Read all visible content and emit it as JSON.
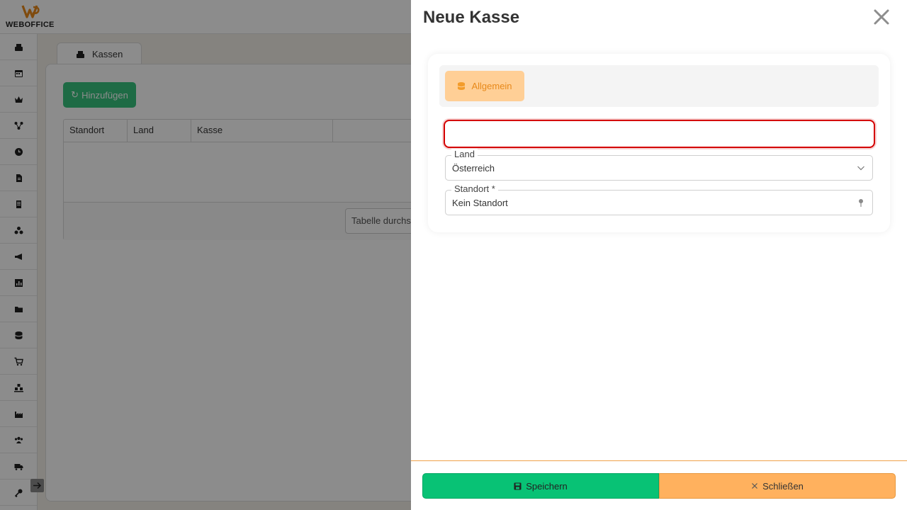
{
  "app": {
    "brand": "WEBOFFICE"
  },
  "sidebar": {
    "items": [
      {
        "icon": "cash-register-icon"
      },
      {
        "icon": "calendar-icon"
      },
      {
        "icon": "crown-icon"
      },
      {
        "icon": "network-icon"
      },
      {
        "icon": "clock-icon"
      },
      {
        "icon": "document-icon"
      },
      {
        "icon": "list-icon"
      },
      {
        "icon": "boxes-icon"
      },
      {
        "icon": "megaphone-icon"
      },
      {
        "icon": "chart-icon"
      },
      {
        "icon": "folder-icon"
      },
      {
        "icon": "database-icon"
      },
      {
        "icon": "cart-icon"
      },
      {
        "icon": "warehouse-icon"
      },
      {
        "icon": "industry-icon"
      },
      {
        "icon": "users-icon"
      },
      {
        "icon": "truck-icon"
      },
      {
        "icon": "key-icon"
      }
    ]
  },
  "main": {
    "tab_label": "Kassen",
    "add_button": "Hinzufügen",
    "table": {
      "columns": [
        "Standort",
        "Land",
        "Kasse",
        ""
      ]
    },
    "search_placeholder": "Tabelle durchs"
  },
  "drawer": {
    "title": "Neue Kasse",
    "tabs": [
      {
        "label": "Allgemein",
        "icon": "database-icon"
      }
    ],
    "name_value": "",
    "country": {
      "label": "Land",
      "value": "Österreich"
    },
    "location": {
      "label": "Standort *",
      "value": "Kein Standort"
    },
    "save_label": "Speichern",
    "close_label": "Schließen"
  },
  "colors": {
    "accent": "#f39c2b",
    "save": "#08c275",
    "close": "#ffb15e",
    "error": "#d40000"
  }
}
